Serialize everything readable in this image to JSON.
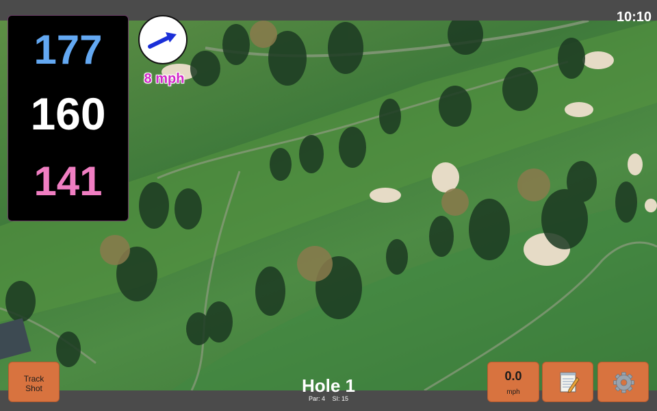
{
  "status": {
    "time": "10:10"
  },
  "distances": {
    "back": "177",
    "middle": "160",
    "front": "141"
  },
  "wind": {
    "speed": "8 mph",
    "direction_icon": "arrow-icon"
  },
  "hole": {
    "title": "Hole 1",
    "par": "Par: 4",
    "stroke_index": "SI: 15"
  },
  "buttons": {
    "track_shot": "Track\nShot",
    "speed_value": "0.0",
    "speed_unit": "mph",
    "notes_icon": "notepad-icon",
    "settings_icon": "gear-icon"
  },
  "colors": {
    "back_distance": "#63a8f2",
    "middle_distance": "#ffffff",
    "front_distance": "#f07ec2",
    "wind_text": "#d227c9",
    "button": "#d8733f"
  }
}
